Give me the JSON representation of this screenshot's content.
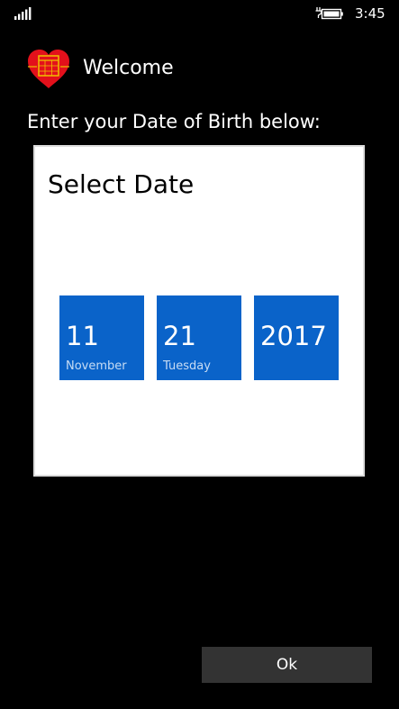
{
  "status_bar": {
    "time": "3:45",
    "icons": [
      "signal-icon",
      "battery-charging-icon"
    ]
  },
  "header": {
    "title": "Welcome",
    "logo": "heart-calendar-logo"
  },
  "prompt": "Enter your Date of Birth below:",
  "date_picker": {
    "title": "Select Date",
    "tiles": [
      {
        "value": "11",
        "caption": "November"
      },
      {
        "value": "21",
        "caption": "Tuesday"
      },
      {
        "value": "2017",
        "caption": ""
      }
    ]
  },
  "ok_button": {
    "label": "Ok"
  },
  "colors": {
    "background": "#000000",
    "tile": "#0a63c9",
    "panel": "#ffffff",
    "button": "#333333",
    "logo_heart": "#e3101b"
  }
}
